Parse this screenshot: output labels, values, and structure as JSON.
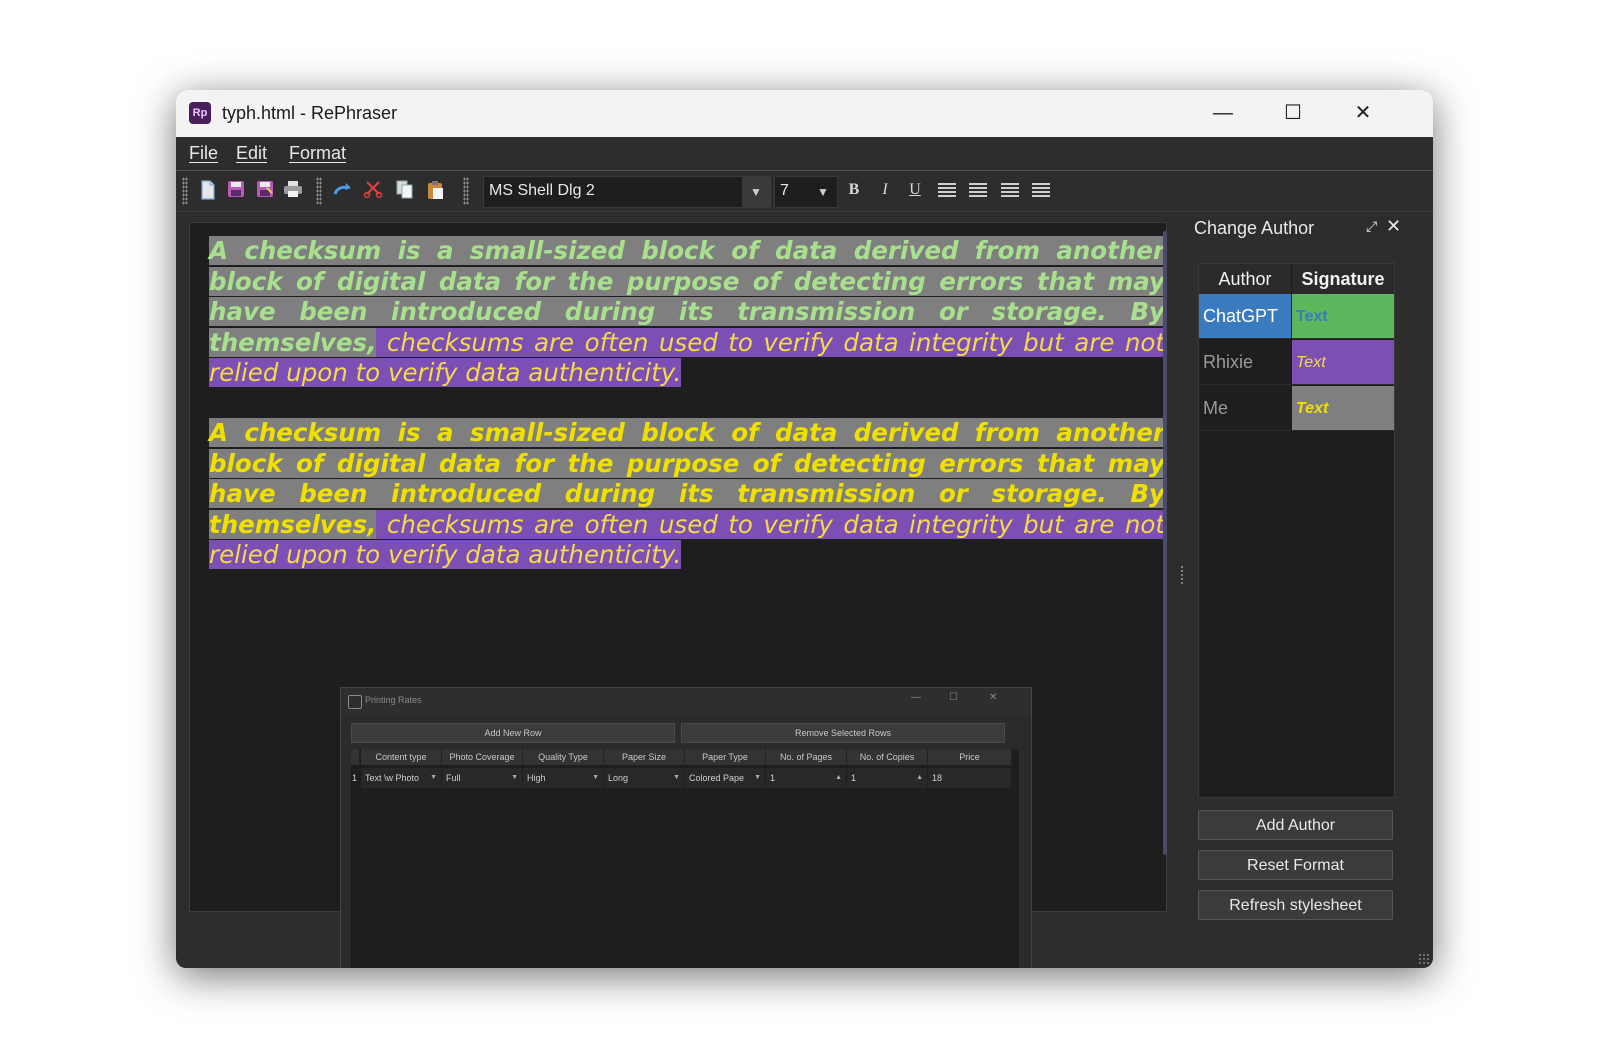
{
  "window": {
    "title": "typh.html - RePhraser",
    "icon_text": "Rp",
    "controls": {
      "minimize": "—",
      "maximize": "☐",
      "close": "✕"
    }
  },
  "menu": {
    "items": [
      "File",
      "Edit",
      "Format"
    ]
  },
  "toolbar": {
    "file_icons": [
      "new-file-icon",
      "save-icon",
      "save-as-icon",
      "print-icon"
    ],
    "edit_icons": [
      "redo-icon",
      "cut-icon",
      "copy-icon",
      "paste-icon"
    ],
    "font_family": "MS Shell Dlg 2",
    "font_size": "7",
    "format_buttons": {
      "bold": "B",
      "italic": "I",
      "underline": "U"
    },
    "align_icons": [
      "align-left-icon",
      "align-center-icon",
      "align-right-icon",
      "align-justify-icon"
    ]
  },
  "editor": {
    "paragraphs": [
      {
        "part1": "A checksum is a small-sized block of data derived from another block of digital data for the purpose of detecting errors that may have been introduced during its transmission or storage. By themselves,",
        "part2": " checksums are often used to verify data integrity but are not relied upon to verify data authenticity."
      },
      {
        "part1": "A checksum is a small-sized block of data derived from another block of digital data for the purpose of detecting errors that may have been introduced during its transmission or storage. By themselves,",
        "part2": " checksums are often used to verify data integrity but are not relied upon to verify data authenticity."
      }
    ],
    "embedded_window": {
      "title": "Printing Rates",
      "add_row_button": "Add New Row",
      "remove_rows_button": "Remove Selected Rows",
      "columns": [
        "Content type",
        "Photo Coverage",
        "Quality Type",
        "Paper Size",
        "Paper Type",
        "No. of Pages",
        "No. of Copies",
        "Price"
      ],
      "row": {
        "index": "1",
        "content_type": "Text \\w Photo",
        "photo_coverage": "Full",
        "quality_type": "High",
        "paper_size": "Long",
        "paper_type": "Colored Pape",
        "pages": "1",
        "copies": "1",
        "price": "18"
      }
    }
  },
  "sidebar": {
    "title": "Change Author",
    "headers": {
      "author": "Author",
      "signature": "Signature"
    },
    "authors": [
      {
        "name": "ChatGPT",
        "signature": "Text",
        "name_bg": "#3a7abf",
        "name_color": "#ffffff",
        "sig_bg": "#5cb85c",
        "sig_color": "#3a7abf"
      },
      {
        "name": "Rhixie",
        "signature": "Text",
        "name_bg": "#1e1e1e",
        "name_color": "#9a9a9a",
        "sig_bg": "#7b4fb3",
        "sig_color": "#f5d94a"
      },
      {
        "name": "Me",
        "signature": "Text",
        "name_bg": "#1e1e1e",
        "name_color": "#9a9a9a",
        "sig_bg": "#7f7f7f",
        "sig_color": "#f0e000"
      }
    ],
    "buttons": {
      "add_author": "Add Author",
      "reset_format": "Reset Format",
      "refresh_stylesheet": "Refresh stylesheet"
    }
  }
}
